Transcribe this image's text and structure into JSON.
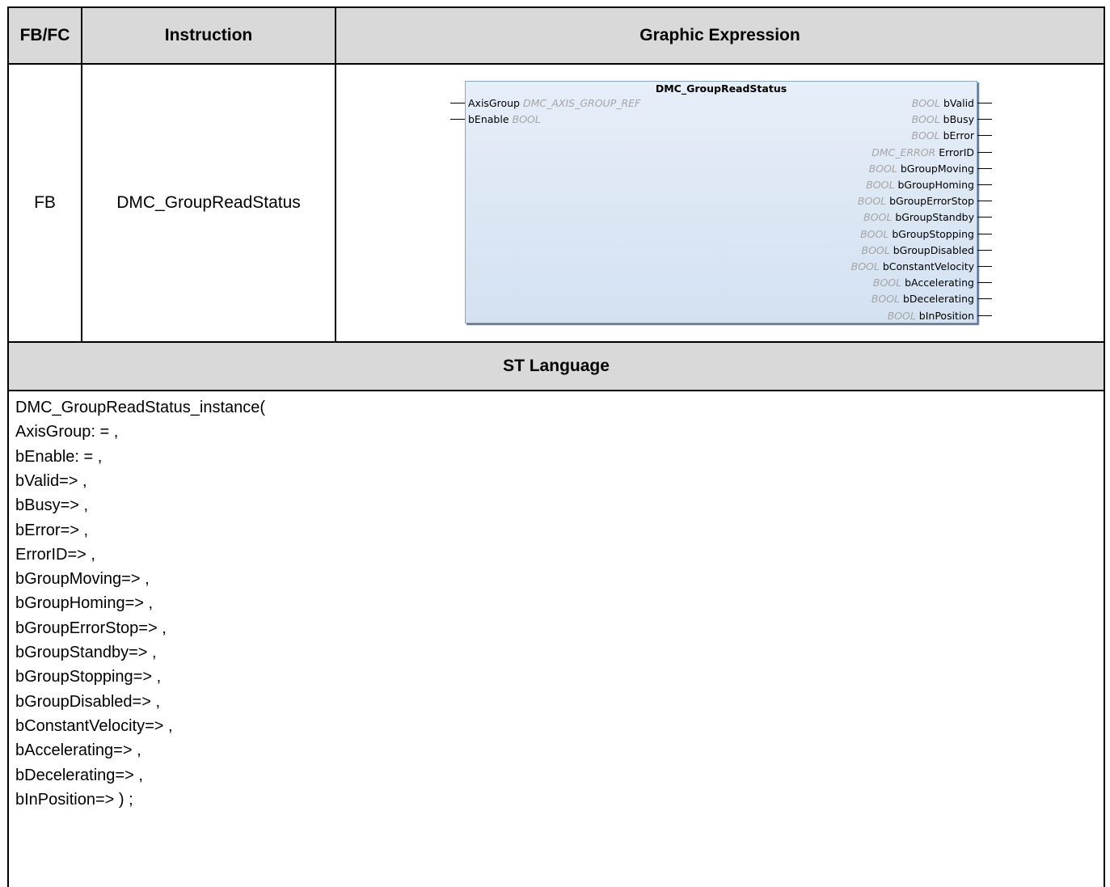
{
  "table": {
    "headers": {
      "fbfc": "FB/FC",
      "instruction": "Instruction",
      "graphic": "Graphic Expression"
    },
    "row": {
      "fbfc": "FB",
      "instruction": "DMC_GroupReadStatus"
    },
    "st_header": "ST Language"
  },
  "block": {
    "name": "DMC_GroupReadStatus",
    "inputs": [
      {
        "name": "AxisGroup",
        "type": "DMC_AXIS_GROUP_REF"
      },
      {
        "name": "bEnable",
        "type": "BOOL"
      }
    ],
    "outputs": [
      {
        "type": "BOOL",
        "name": "bValid"
      },
      {
        "type": "BOOL",
        "name": "bBusy"
      },
      {
        "type": "BOOL",
        "name": "bError"
      },
      {
        "type": "DMC_ERROR",
        "name": "ErrorID"
      },
      {
        "type": "BOOL",
        "name": "bGroupMoving"
      },
      {
        "type": "BOOL",
        "name": "bGroupHoming"
      },
      {
        "type": "BOOL",
        "name": "bGroupErrorStop"
      },
      {
        "type": "BOOL",
        "name": "bGroupStandby"
      },
      {
        "type": "BOOL",
        "name": "bGroupStopping"
      },
      {
        "type": "BOOL",
        "name": "bGroupDisabled"
      },
      {
        "type": "BOOL",
        "name": "bConstantVelocity"
      },
      {
        "type": "BOOL",
        "name": "bAccelerating"
      },
      {
        "type": "BOOL",
        "name": "bDecelerating"
      },
      {
        "type": "BOOL",
        "name": "bInPosition"
      }
    ]
  },
  "st_code": [
    "DMC_GroupReadStatus_instance(",
    "AxisGroup: = ,",
    "bEnable: = ,",
    "bValid=> ,",
    "bBusy=> ,",
    "bError=> ,",
    "ErrorID=> ,",
    "bGroupMoving=> ,",
    "bGroupHoming=> ,",
    "bGroupErrorStop=> ,",
    "bGroupStandby=> ,",
    "bGroupStopping=> ,",
    "bGroupDisabled=> ,",
    "bConstantVelocity=> ,",
    "bAccelerating=> ,",
    "bDecelerating=> ,",
    "bInPosition=> ) ;"
  ]
}
